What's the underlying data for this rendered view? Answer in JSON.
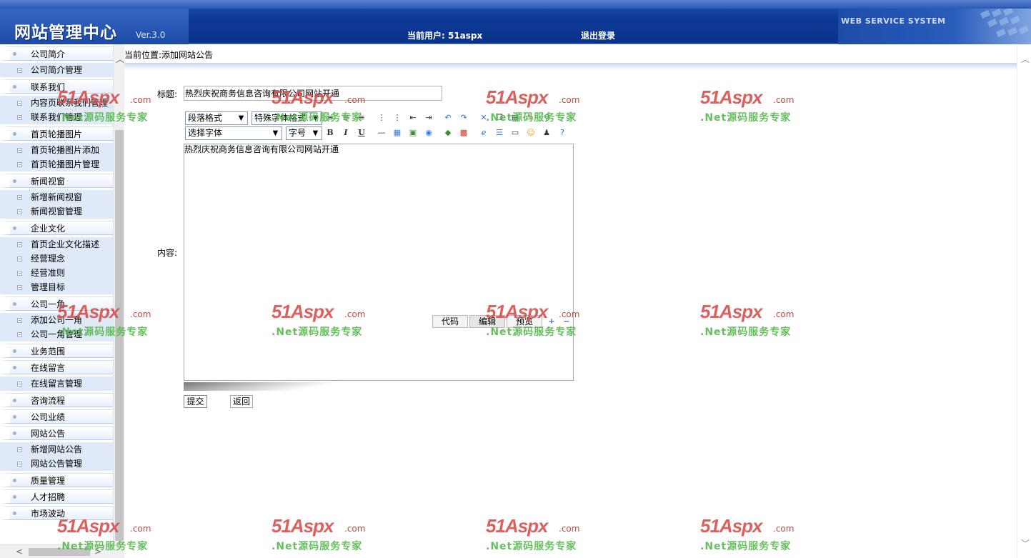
{
  "header": {
    "logo_title": "网站管理中心",
    "version": "Ver.3.0",
    "current_user": "当前用户: 51aspx",
    "logout": "退出登录",
    "system_name": "WEB SERVICE SYSTEM"
  },
  "sidebar": {
    "items": [
      {
        "type": "group",
        "label": "公司简介"
      },
      {
        "type": "sub",
        "label": "公司简介管理"
      },
      {
        "type": "group",
        "label": "联系我们"
      },
      {
        "type": "sub",
        "label": "内容页联系我们管理"
      },
      {
        "type": "sub",
        "label": "联系我们管理"
      },
      {
        "type": "group",
        "label": "首页轮播图片"
      },
      {
        "type": "sub",
        "label": "首页轮播图片添加"
      },
      {
        "type": "sub",
        "label": "首页轮播图片管理"
      },
      {
        "type": "group",
        "label": "新闻视窗"
      },
      {
        "type": "sub",
        "label": "新增新闻视窗"
      },
      {
        "type": "sub",
        "label": "新闻视窗管理"
      },
      {
        "type": "group",
        "label": "企业文化"
      },
      {
        "type": "sub",
        "label": "首页企业文化描述"
      },
      {
        "type": "sub",
        "label": "经营理念"
      },
      {
        "type": "sub",
        "label": "经营准则"
      },
      {
        "type": "sub",
        "label": "管理目标"
      },
      {
        "type": "group",
        "label": "公司一角"
      },
      {
        "type": "sub",
        "label": "添加公司一角"
      },
      {
        "type": "sub",
        "label": "公司一角管理"
      },
      {
        "type": "group",
        "label": "业务范围"
      },
      {
        "type": "group",
        "label": "在线留言"
      },
      {
        "type": "sub",
        "label": "在线留言管理"
      },
      {
        "type": "group",
        "label": "咨询流程"
      },
      {
        "type": "group",
        "label": "公司业绩"
      },
      {
        "type": "group",
        "label": "网站公告"
      },
      {
        "type": "sub",
        "label": "新增网站公告"
      },
      {
        "type": "sub",
        "label": "网站公告管理"
      },
      {
        "type": "group",
        "label": "质量管理"
      },
      {
        "type": "group",
        "label": "人才招聘"
      },
      {
        "type": "group",
        "label": "市场波动"
      }
    ]
  },
  "main": {
    "breadcrumb": "当前位置:添加网站公告",
    "title_label": "标题:",
    "title_value": "热烈庆祝商务信息咨询有限公司网站开通",
    "content_label": "内容:",
    "content_value": "热烈庆祝商务信息咨询有限公司网站开通",
    "toolbar": {
      "paragraph_format": "段落格式",
      "special_format": "特殊字体格式",
      "font_select": "选择字体",
      "font_size": "字号",
      "bold": "B",
      "italic": "I",
      "underline": "U"
    },
    "editor_tabs": {
      "code": "代码",
      "edit": "编辑",
      "preview": "预览"
    },
    "submit": "提交",
    "back": "返回"
  },
  "watermark": {
    "brand": "51Aspx",
    "domain": ".com",
    "slogan": ".Net源码服务专家"
  },
  "colors": {
    "header_blue": "#0d3a96",
    "sidebar_sub_bg": "#dfe9f7",
    "watermark_red": "#d8504e",
    "watermark_green": "#56b84e"
  }
}
